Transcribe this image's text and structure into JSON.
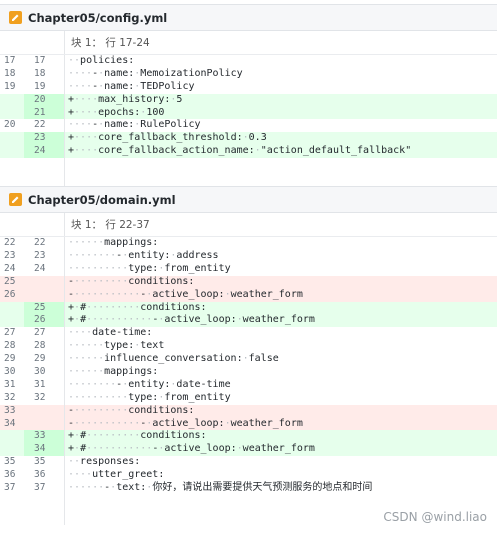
{
  "files": [
    {
      "name": "Chapter05/config.yml",
      "chunk": "块 1： 行 17-24",
      "lines": [
        {
          "type": "ctx",
          "old": "17",
          "new": "17",
          "text": "··policies:"
        },
        {
          "type": "ctx",
          "old": "18",
          "new": "18",
          "text": "····-·name:·MemoizationPolicy"
        },
        {
          "type": "ctx",
          "old": "19",
          "new": "19",
          "text": "····-·name:·TEDPolicy"
        },
        {
          "type": "add",
          "old": "",
          "new": "20",
          "text": "+····max_history:·5"
        },
        {
          "type": "add",
          "old": "",
          "new": "21",
          "text": "+····epochs:·100"
        },
        {
          "type": "ctx",
          "old": "20",
          "new": "22",
          "text": "····-·name:·RulePolicy"
        },
        {
          "type": "add",
          "old": "",
          "new": "23",
          "text": "+····core_fallback_threshold:·0.3"
        },
        {
          "type": "add",
          "old": "",
          "new": "24",
          "text": "+····core_fallback_action_name:·\"action_default_fallback\""
        }
      ]
    },
    {
      "name": "Chapter05/domain.yml",
      "chunk": "块 1： 行 22-37",
      "lines": [
        {
          "type": "ctx",
          "old": "22",
          "new": "22",
          "text": "······mappings:"
        },
        {
          "type": "ctx",
          "old": "23",
          "new": "23",
          "text": "········-·entity:·address"
        },
        {
          "type": "ctx",
          "old": "24",
          "new": "24",
          "text": "··········type:·from_entity"
        },
        {
          "type": "del",
          "old": "25",
          "new": "",
          "text": "-·········conditions:"
        },
        {
          "type": "del",
          "old": "26",
          "new": "",
          "text": "-···········-·active_loop:·weather_form"
        },
        {
          "type": "add",
          "old": "",
          "new": "25",
          "text": "+·#·········conditions:"
        },
        {
          "type": "add",
          "old": "",
          "new": "26",
          "text": "+·#···········-·active_loop:·weather_form"
        },
        {
          "type": "ctx",
          "old": "27",
          "new": "27",
          "text": "····date-time:"
        },
        {
          "type": "ctx",
          "old": "28",
          "new": "28",
          "text": "······type:·text"
        },
        {
          "type": "ctx",
          "old": "29",
          "new": "29",
          "text": "······influence_conversation:·false"
        },
        {
          "type": "ctx",
          "old": "30",
          "new": "30",
          "text": "······mappings:"
        },
        {
          "type": "ctx",
          "old": "31",
          "new": "31",
          "text": "········-·entity:·date-time"
        },
        {
          "type": "ctx",
          "old": "32",
          "new": "32",
          "text": "··········type:·from_entity"
        },
        {
          "type": "del",
          "old": "33",
          "new": "",
          "text": "-·········conditions:"
        },
        {
          "type": "del",
          "old": "34",
          "new": "",
          "text": "-···········-·active_loop:·weather_form"
        },
        {
          "type": "add",
          "old": "",
          "new": "33",
          "text": "+·#·········conditions:"
        },
        {
          "type": "add",
          "old": "",
          "new": "34",
          "text": "+·#···········-·active_loop:·weather_form"
        },
        {
          "type": "ctx",
          "old": "35",
          "new": "35",
          "text": "··responses:"
        },
        {
          "type": "ctx",
          "old": "36",
          "new": "36",
          "text": "····utter_greet:"
        },
        {
          "type": "ctx",
          "old": "37",
          "new": "37",
          "text": "······-·text:·你好，请说出需要提供天气预测服务的地点和时间"
        }
      ]
    }
  ],
  "watermark": "CSDN @wind.liao",
  "colors": {
    "add": "#e6ffec",
    "del": "#ffebe9",
    "icon": "#f0a020"
  }
}
